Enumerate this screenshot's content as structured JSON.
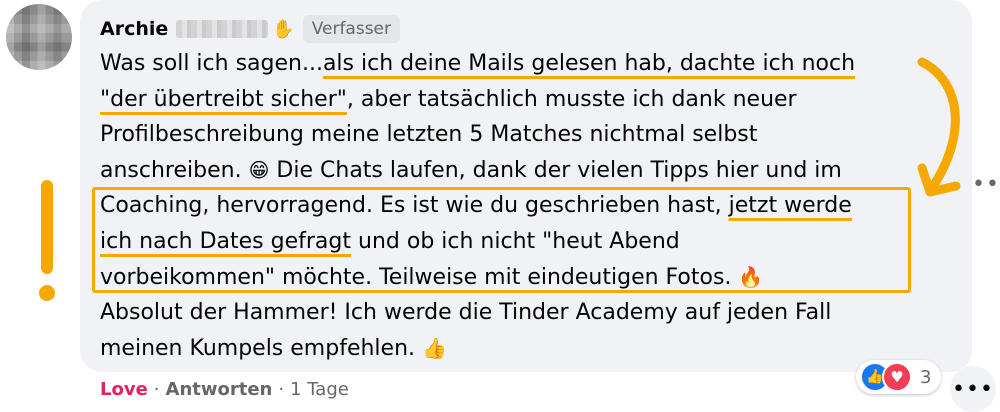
{
  "comment": {
    "author": "Archie",
    "badge": "Verfasser",
    "lines": [
      [
        "Was soll ich sagen...",
        "als ich deine Mails gelesen hab, dachte ich noch"
      ],
      [
        "\"der übertreibt sicher\"",
        ", aber tatsächlich musste ich dank neuer"
      ],
      [
        "Profilbeschreibung meine letzten 5 Matches nichtmal selbst"
      ],
      [
        "anschreiben. ",
        "😁",
        " Die Chats laufen, dank der vielen Tipps hier und im"
      ],
      [
        "Coaching, hervorragend. ",
        "Es ist wie du geschrieben hast, ",
        "jetzt werde"
      ],
      [
        "ich nach Dates gefragt",
        " und ob ich nicht \"heut Abend"
      ],
      [
        "vorbeikommen\" möchte. Teilweise mit eindeutigen Fotos. ",
        "🔥"
      ],
      [
        "Absolut der Hammer! Ich werde die Tinder Academy auf jeden Fall"
      ],
      [
        "meinen Kumpels empfehlen. ",
        "👍"
      ]
    ]
  },
  "footer": {
    "like_label": "Love",
    "reply_label": "Antworten",
    "time": "1 Tage"
  },
  "reactions": {
    "count": "3",
    "icons": [
      "like-icon",
      "love-icon"
    ]
  },
  "colors": {
    "highlight": "#f5a800",
    "love": "#e0245e",
    "bubble": "#f0f2f5"
  }
}
